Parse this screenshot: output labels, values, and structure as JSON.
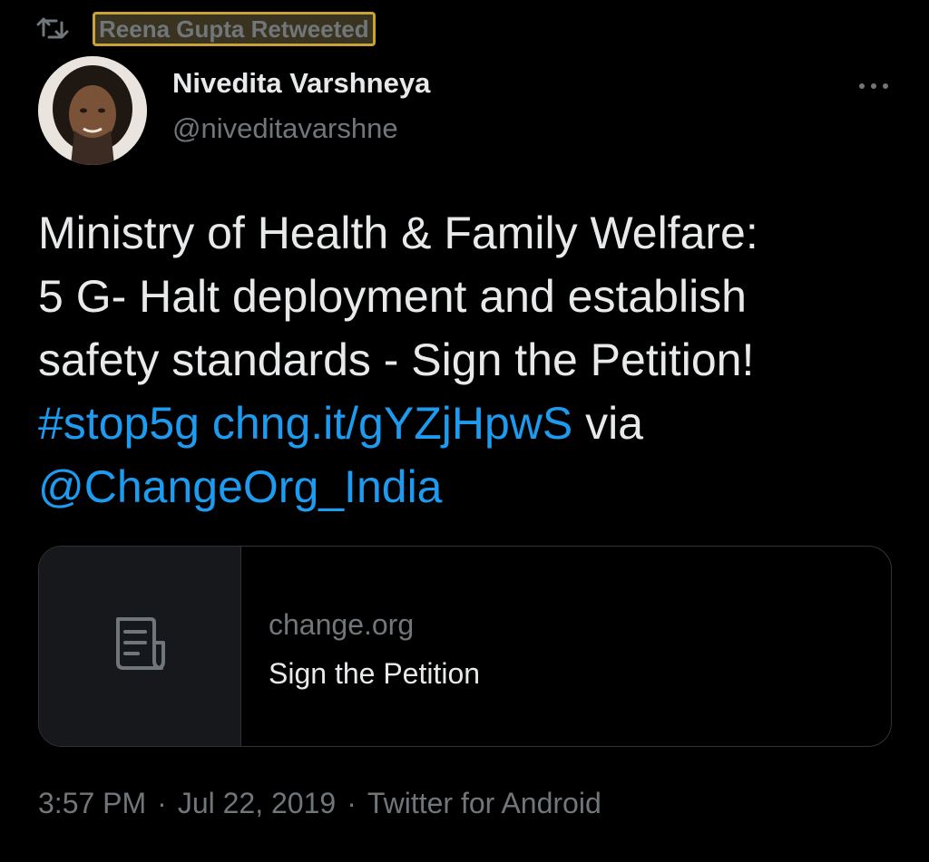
{
  "retweet": {
    "icon": "retweet-icon",
    "label": "Reena Gupta Retweeted"
  },
  "author": {
    "display_name": "Nivedita Varshneya",
    "handle": "@niveditavarshne"
  },
  "more_icon": "more-horizontal-icon",
  "tweet": {
    "line1": "Ministry of Health & Family Welfare:",
    "line2": "5 G- Halt deployment and establish",
    "line3": "safety standards - Sign the Petition!",
    "hashtag": "#stop5g",
    "short_link": "chng.it/gYZjHpwS",
    "via": "via",
    "mention": "@ChangeOrg_India"
  },
  "card": {
    "icon": "document-icon",
    "domain": "change.org",
    "title": "Sign the Petition"
  },
  "meta": {
    "time": "3:57 PM",
    "separator": "·",
    "date": "Jul 22, 2019",
    "source": "Twitter for Android"
  },
  "colors": {
    "background": "#000000",
    "text": "#e7e9ea",
    "secondary": "#71767b",
    "link": "#1d9bf0",
    "border": "#2f3336",
    "highlight": "#c8a33a"
  }
}
